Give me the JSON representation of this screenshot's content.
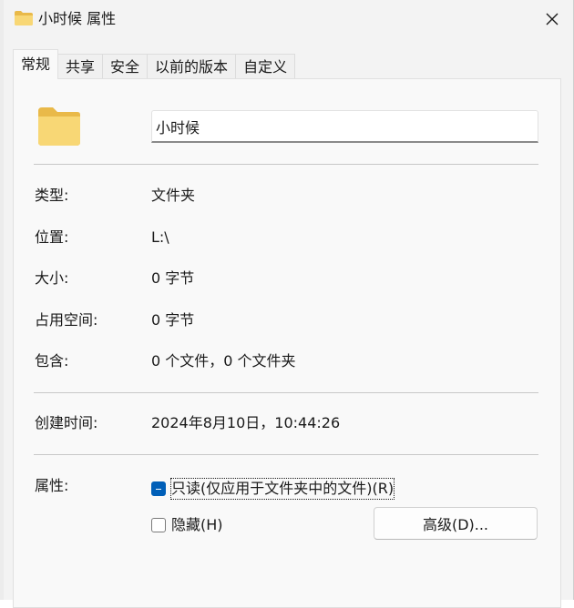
{
  "window": {
    "title": "小时候 属性",
    "icon": "folder-icon",
    "close_icon": "close-icon"
  },
  "tabs": [
    {
      "label": "常规",
      "active": true
    },
    {
      "label": "共享",
      "active": false
    },
    {
      "label": "安全",
      "active": false
    },
    {
      "label": "以前的版本",
      "active": false
    },
    {
      "label": "自定义",
      "active": false
    }
  ],
  "general": {
    "folder_icon": "folder-icon",
    "name_value": "小时候",
    "type_label": "类型:",
    "type_value": "文件夹",
    "location_label": "位置:",
    "location_value": "L:\\",
    "size_label": "大小:",
    "size_value": "0 字节",
    "size_on_disk_label": "占用空间:",
    "size_on_disk_value": "0 字节",
    "contains_label": "包含:",
    "contains_value": "0 个文件，0 个文件夹",
    "created_label": "创建时间:",
    "created_value": "2024年8月10日，10:44:26",
    "attributes_label": "属性:",
    "readonly_label": "只读(仅应用于文件夹中的文件)(R)",
    "readonly_state": "indeterminate",
    "hidden_label": "隐藏(H)",
    "hidden_checked": false,
    "advanced_button": "高级(D)..."
  },
  "colors": {
    "accent": "#005fb8",
    "folder": "#f8d775",
    "folder_dark": "#e9b949"
  }
}
